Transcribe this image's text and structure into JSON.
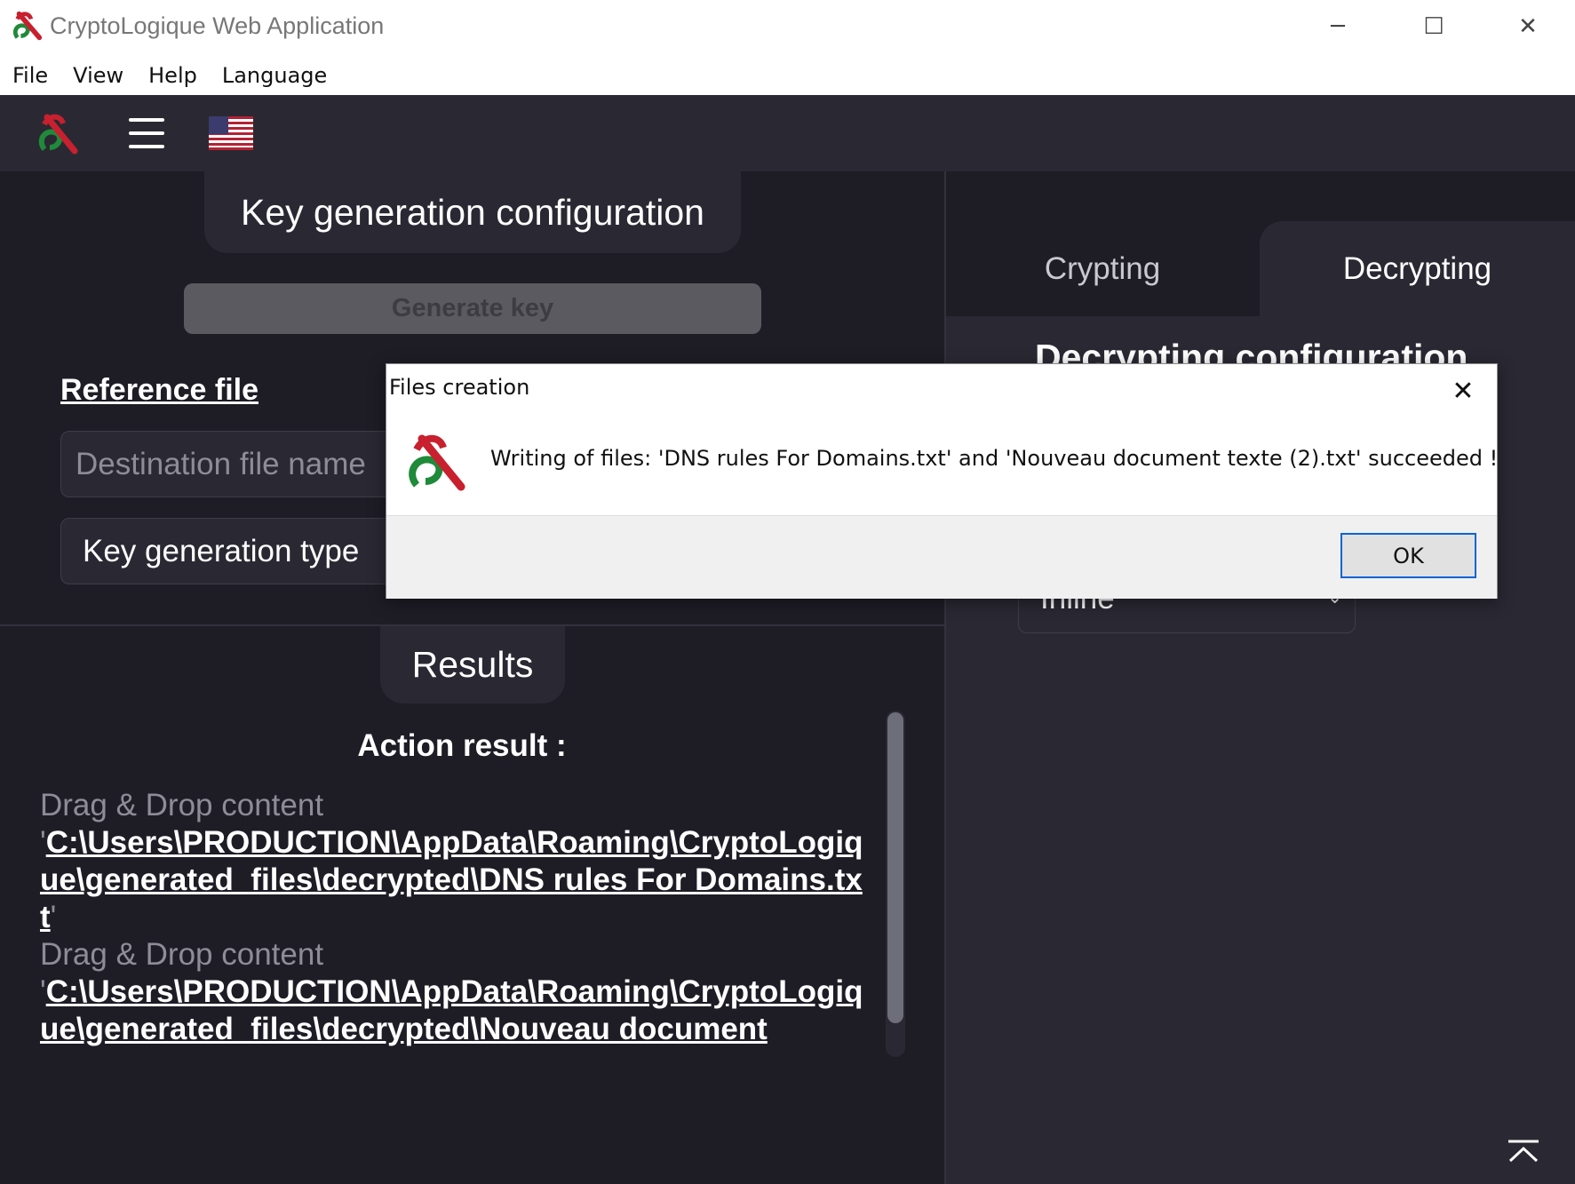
{
  "window": {
    "title": "CryptoLogique Web Application",
    "controls": {
      "minimize": "─",
      "maximize": "☐",
      "close": "✕"
    }
  },
  "menubar": {
    "items": [
      "File",
      "View",
      "Help",
      "Language"
    ]
  },
  "toolbar": {
    "logo": "cryptologique-logo",
    "menu_icon": "hamburger-icon",
    "language_flag": "us-flag-icon"
  },
  "left": {
    "key_config_title": "Key generation configuration",
    "generate_button": "Generate key",
    "reference_link": "Reference file",
    "destination_placeholder": "Destination file name",
    "key_type_label": "Key generation type",
    "results_title": "Results",
    "action_result_title": "Action result :",
    "results": [
      {
        "label": "Drag & Drop content",
        "path": "C:\\Users\\PRODUCTION\\AppData\\Roaming\\CryptoLogique\\generated_files\\decrypted\\DNS rules For Domains.txt",
        "open_quote": "'",
        "close_quote": "'"
      },
      {
        "label": "Drag & Drop content",
        "path": "C:\\Users\\PRODUCTION\\AppData\\Roaming\\CryptoLogique\\generated_files\\decrypted\\Nouveau document",
        "open_quote": "'",
        "close_quote": ""
      }
    ]
  },
  "right": {
    "tabs": [
      {
        "label": "Crypting",
        "active": false
      },
      {
        "label": "Decrypting",
        "active": true
      }
    ],
    "config_title": "Decrypting configuration",
    "select_value": "Inline",
    "select_chevron": "⌄"
  },
  "dialog": {
    "title": "Files creation",
    "message": "Writing of files: 'DNS rules For Domains.txt' and 'Nouveau document texte (2).txt' succeeded !",
    "ok_label": "OK",
    "close_glyph": "✕"
  },
  "colors": {
    "background": "#1e1d26",
    "panel": "#2a2933",
    "logo_red": "#c8202e",
    "logo_green": "#1f8a3a",
    "dialog_accent": "#0a64d6"
  }
}
